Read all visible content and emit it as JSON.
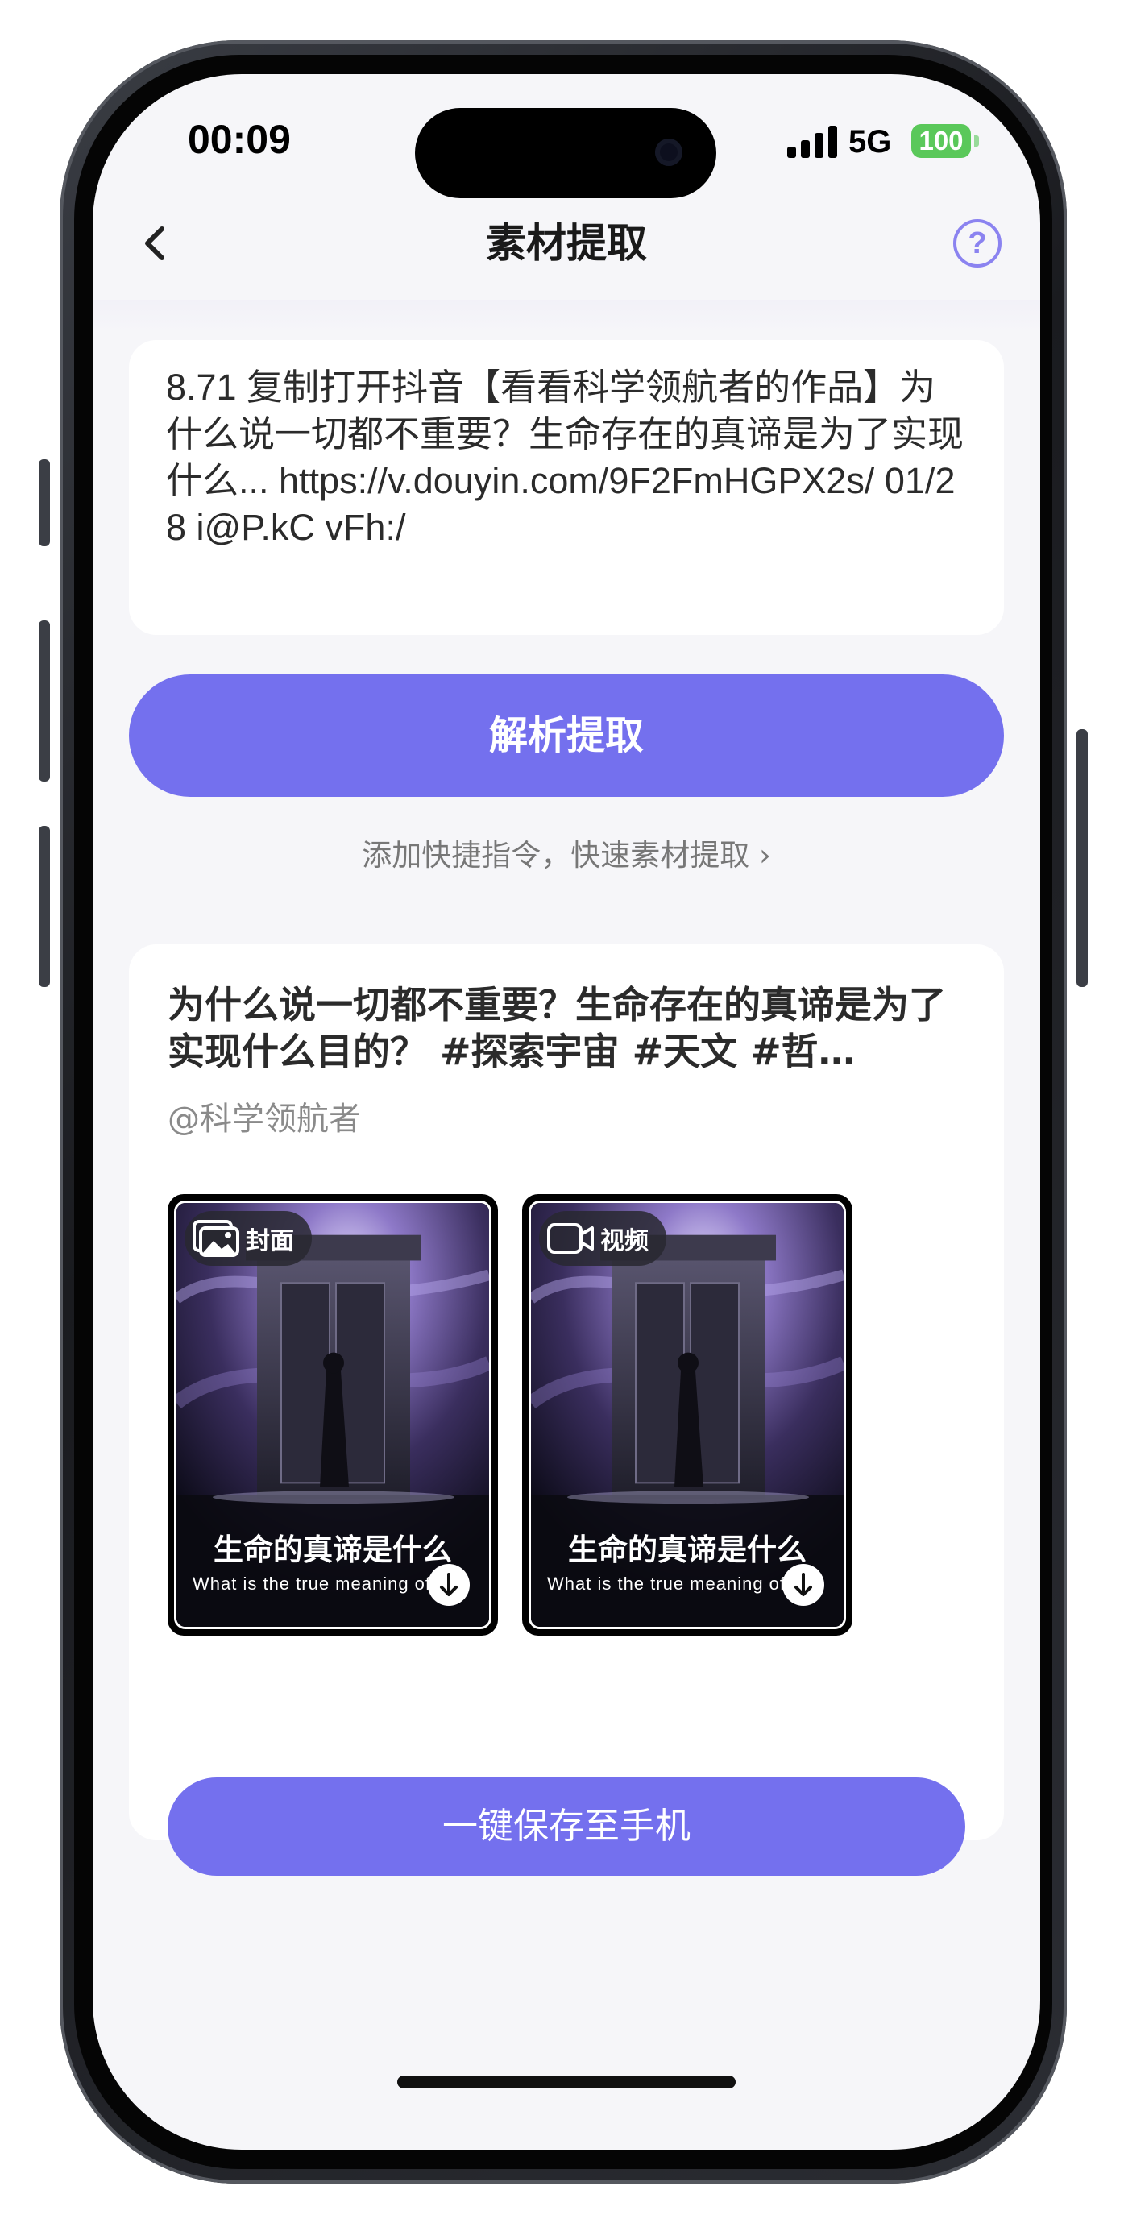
{
  "status_bar": {
    "time": "00:09",
    "network": "5G",
    "battery": "100"
  },
  "nav": {
    "title": "素材提取",
    "back_icon": "chevron-left-icon",
    "help_icon": "question-circle-icon",
    "help_glyph": "?"
  },
  "link_input": {
    "value": "8.71 复制打开抖音【看看科学领航者的作品】为什么说一切都不重要？生命存在的真谛是为了实现什么... https://v.douyin.com/9F2FmHGPX2s/ 01/28 i@P.kC vFh:/"
  },
  "parse_button": {
    "label": "解析提取"
  },
  "shortcut": {
    "label": "添加快捷指令，快速素材提取 ›"
  },
  "result": {
    "title": "为什么说一切都不重要？生命存在的真谛是为了实现什么目的？ #探索宇宙 #天文 #哲…",
    "author": "@科学领航者",
    "items": [
      {
        "badge": "封面",
        "icon": "image-icon",
        "caption": "生命的真谛是什么",
        "subcaption": "What is the true meaning of life"
      },
      {
        "badge": "视频",
        "icon": "video-icon",
        "caption": "生命的真谛是什么",
        "subcaption": "What is the true meaning of life"
      }
    ],
    "save_button": {
      "label": "一键保存至手机"
    }
  },
  "colors": {
    "accent": "#7470ee",
    "battery": "#5ac85a",
    "help": "#8b83f0"
  }
}
